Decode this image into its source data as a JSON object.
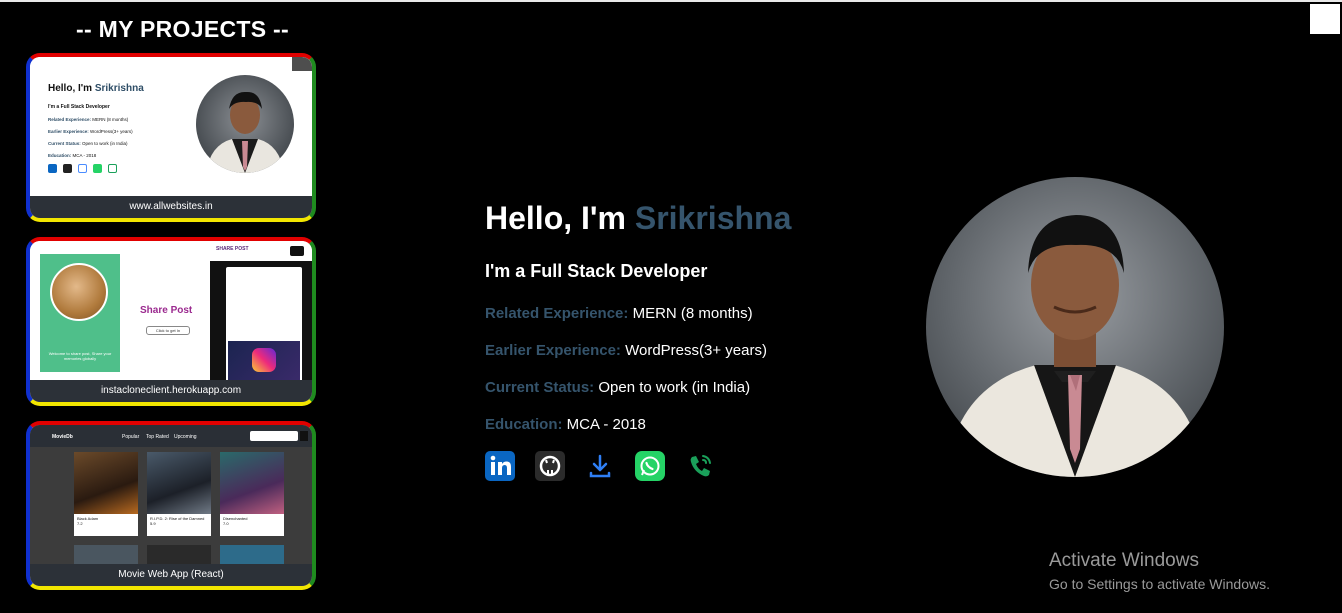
{
  "sidebar": {
    "title": "-- MY PROJECTS --",
    "projects": [
      {
        "label": "www.allwebsites.in",
        "preview": {
          "hello": "Hello, I'm ",
          "name": "Srikrishna",
          "role": "I'm a Full Stack Developer",
          "lines": [
            {
              "key": "Related Experience:",
              "value": " MERN (8 months)"
            },
            {
              "key": "Earlier Experience:",
              "value": " WordPress(3+ years)"
            },
            {
              "key": "Current Status:",
              "value": " Open to work (in India)"
            },
            {
              "key": "Education:",
              "value": " MCA - 2018"
            }
          ]
        }
      },
      {
        "label": "instacloneclient.herokuapp.com",
        "preview": {
          "title": "Share Post",
          "button": "Click to get In",
          "welcome": "Welcome to share post, Share your memories globally",
          "header": "SHARE POST"
        }
      },
      {
        "label": "Movie Web App (React)",
        "preview": {
          "brand": "MovieDb",
          "nav": [
            "Popular",
            "Top Rated",
            "Upcoming"
          ],
          "search_placeholder": "Search Movie here",
          "movies": [
            {
              "title": "Black Adam",
              "rating": "7.2"
            },
            {
              "title": "R.I.P.D. 2: Rise of the Damned",
              "rating": "5.9"
            },
            {
              "title": "Disenchanted",
              "rating": "7.0"
            }
          ]
        }
      }
    ]
  },
  "hero": {
    "greeting": "Hello, I'm ",
    "name": "Srikrishna",
    "role": "I'm a Full Stack Developer",
    "details": [
      {
        "key": "Related Experience:",
        "value": " MERN (8 months)"
      },
      {
        "key": "Earlier Experience:",
        "value": " WordPress(3+ years)"
      },
      {
        "key": "Current Status:",
        "value": " Open to work (in India)"
      },
      {
        "key": "Education:",
        "value": " MCA - 2018"
      }
    ],
    "social_icons": [
      "linkedin-icon",
      "github-icon",
      "download-icon",
      "whatsapp-icon",
      "phone-icon"
    ]
  },
  "watermark": {
    "line1": "Activate Windows",
    "line2": "Go to Settings to activate Windows."
  },
  "colors": {
    "accent": "#35546c",
    "background": "#000000",
    "card_border_top": "#e10000",
    "card_border_right": "#1f8b1f",
    "card_border_bottom": "#f2e600",
    "card_border_left": "#1030d0"
  }
}
